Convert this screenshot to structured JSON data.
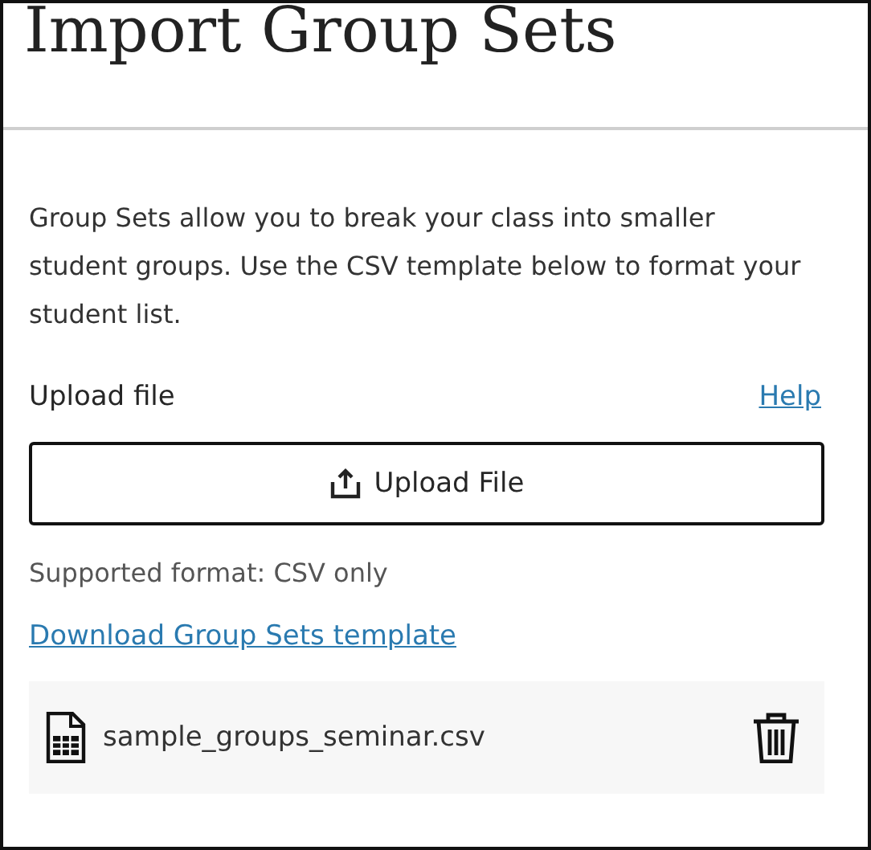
{
  "header": {
    "title": "Import Group Sets"
  },
  "description": "Group Sets allow you to break your class into smaller student groups. Use the CSV template below to format your student list.",
  "upload": {
    "label": "Upload file",
    "help_link": "Help",
    "button": "Upload File",
    "format_note": "Supported format: CSV only",
    "template_link": "Download Group Sets template"
  },
  "files": [
    {
      "name": "sample_groups_seminar.csv"
    }
  ]
}
